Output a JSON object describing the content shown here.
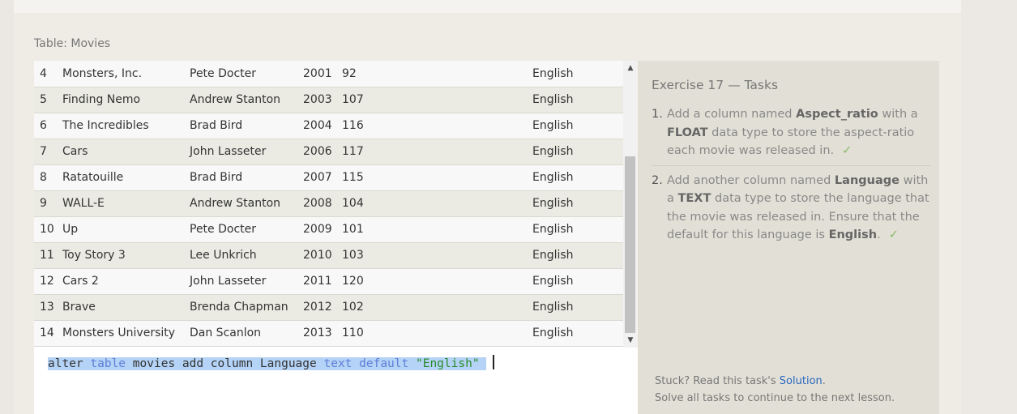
{
  "table_title": "Table: Movies",
  "rows": [
    {
      "id": "4",
      "title": "Monsters, Inc.",
      "director": "Pete Docter",
      "year": "2001",
      "length": "92",
      "language": "English"
    },
    {
      "id": "5",
      "title": "Finding Nemo",
      "director": "Andrew Stanton",
      "year": "2003",
      "length": "107",
      "language": "English"
    },
    {
      "id": "6",
      "title": "The Incredibles",
      "director": "Brad Bird",
      "year": "2004",
      "length": "116",
      "language": "English"
    },
    {
      "id": "7",
      "title": "Cars",
      "director": "John Lasseter",
      "year": "2006",
      "length": "117",
      "language": "English"
    },
    {
      "id": "8",
      "title": "Ratatouille",
      "director": "Brad Bird",
      "year": "2007",
      "length": "115",
      "language": "English"
    },
    {
      "id": "9",
      "title": "WALL-E",
      "director": "Andrew Stanton",
      "year": "2008",
      "length": "104",
      "language": "English"
    },
    {
      "id": "10",
      "title": "Up",
      "director": "Pete Docter",
      "year": "2009",
      "length": "101",
      "language": "English"
    },
    {
      "id": "11",
      "title": "Toy Story 3",
      "director": "Lee Unkrich",
      "year": "2010",
      "length": "103",
      "language": "English"
    },
    {
      "id": "12",
      "title": "Cars 2",
      "director": "John Lasseter",
      "year": "2011",
      "length": "120",
      "language": "English"
    },
    {
      "id": "13",
      "title": "Brave",
      "director": "Brenda Chapman",
      "year": "2012",
      "length": "102",
      "language": "English"
    },
    {
      "id": "14",
      "title": "Monsters University",
      "director": "Dan Scanlon",
      "year": "2013",
      "length": "110",
      "language": "English"
    }
  ],
  "scrollbar": {
    "up_icon": "triangle-up-icon",
    "down_icon": "triangle-down-icon",
    "position": 0.55
  },
  "editor": {
    "tokens": [
      {
        "text": "alter ",
        "type": "plain"
      },
      {
        "text": "table",
        "type": "keyword"
      },
      {
        "text": " movies add column Language ",
        "type": "plain"
      },
      {
        "text": "text",
        "type": "keyword"
      },
      {
        "text": " ",
        "type": "plain"
      },
      {
        "text": "default",
        "type": "keyword"
      },
      {
        "text": " ",
        "type": "plain"
      },
      {
        "text": "\"English\"",
        "type": "string"
      },
      {
        "text": " ",
        "type": "plain"
      }
    ]
  },
  "tasks": {
    "title": "Exercise 17 — Tasks",
    "items": [
      {
        "num": "1.",
        "parts": [
          {
            "t": "Add a column named ",
            "b": false
          },
          {
            "t": "Aspect_ratio",
            "b": true
          },
          {
            "t": " with a ",
            "b": false
          },
          {
            "t": "FLOAT",
            "b": true
          },
          {
            "t": " data type to store the aspect-ratio each movie was released in.",
            "b": false
          }
        ],
        "done": true
      },
      {
        "num": "2.",
        "parts": [
          {
            "t": "Add another column named ",
            "b": false
          },
          {
            "t": "Language",
            "b": true
          },
          {
            "t": " with a ",
            "b": false
          },
          {
            "t": "TEXT",
            "b": true
          },
          {
            "t": " data type to store the language that the movie was released in. Ensure that the default for this language is ",
            "b": false
          },
          {
            "t": "English",
            "b": true
          },
          {
            "t": ".",
            "b": false
          }
        ],
        "done": true
      }
    ],
    "check_glyph": "✓",
    "footer_prefix": "Stuck? Read this task's ",
    "footer_link": "Solution",
    "footer_suffix": ".",
    "footer_line2": "Solve all tasks to continue to the next lesson."
  },
  "colors": {
    "keyword": "#5e7ed8",
    "string": "#2a8a2a",
    "selection": "#b4d3f6",
    "link": "#2a66c0",
    "check": "#8ab86a"
  }
}
